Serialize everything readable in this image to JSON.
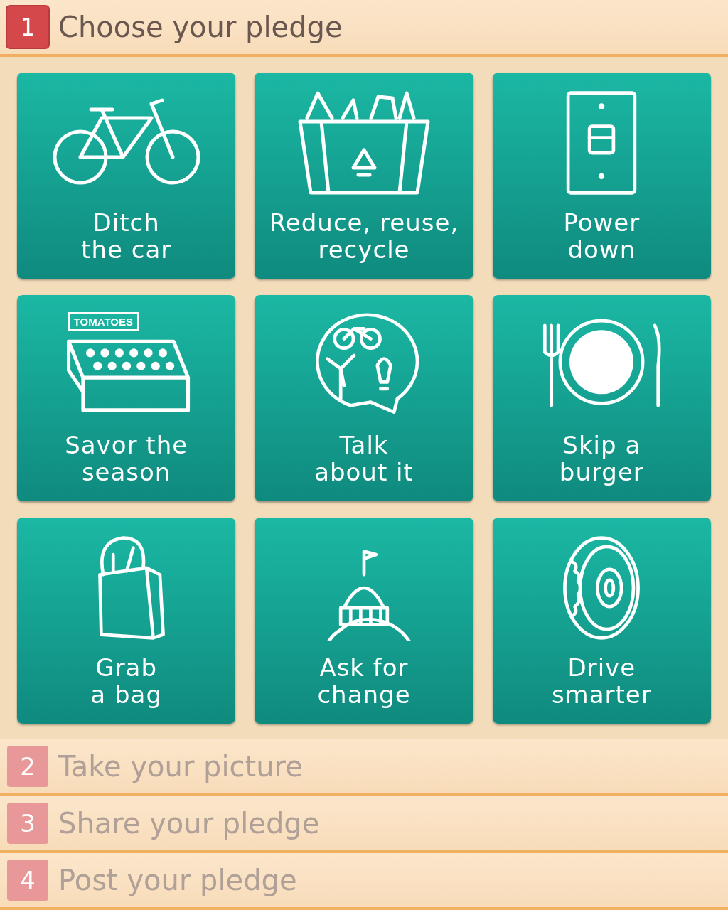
{
  "steps": [
    {
      "number": "1",
      "title": "Choose your pledge",
      "selected": true,
      "tiles": [
        {
          "kind": "bike",
          "lines": [
            "Ditch",
            "the car"
          ]
        },
        {
          "kind": "recycle",
          "lines": [
            "Reduce, reuse,",
            "recycle"
          ]
        },
        {
          "kind": "switch",
          "lines": [
            "Power",
            "down"
          ]
        },
        {
          "kind": "crate",
          "sign": "TOMATOES",
          "lines": [
            "Savor the",
            "season"
          ]
        },
        {
          "kind": "bubble",
          "lines": [
            "Talk",
            "about it"
          ]
        },
        {
          "kind": "plate",
          "lines": [
            "Skip a",
            "burger"
          ]
        },
        {
          "kind": "bag",
          "lines": [
            "Grab",
            "a bag"
          ]
        },
        {
          "kind": "capitol",
          "lines": [
            "Ask for",
            "change"
          ]
        },
        {
          "kind": "tire",
          "lines": [
            "Drive",
            "smarter"
          ]
        }
      ]
    },
    {
      "number": "2",
      "title": "Take your picture",
      "selected": false
    },
    {
      "number": "3",
      "title": "Share your pledge",
      "selected": false
    },
    {
      "number": "4",
      "title": "Post your pledge",
      "selected": false
    }
  ]
}
